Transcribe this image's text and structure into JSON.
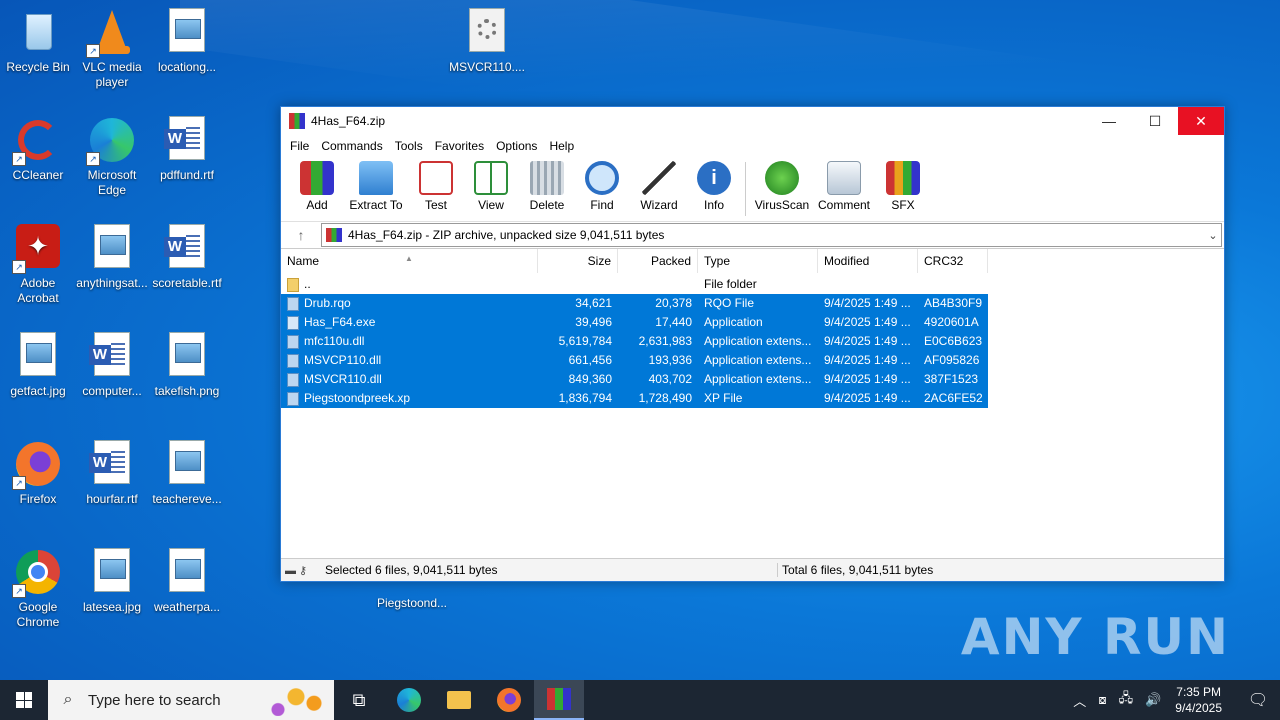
{
  "desktop": {
    "icons": [
      {
        "label": "Recycle Bin"
      },
      {
        "label": "VLC media player"
      },
      {
        "label": "locationg..."
      },
      {
        "label": "MSVCR110...."
      },
      {
        "label": "CCleaner"
      },
      {
        "label": "Microsoft Edge"
      },
      {
        "label": "pdffund.rtf"
      },
      {
        "label": "Adobe Acrobat"
      },
      {
        "label": "anythingsat..."
      },
      {
        "label": "scoretable.rtf"
      },
      {
        "label": "getfact.jpg"
      },
      {
        "label": "computer..."
      },
      {
        "label": "takefish.png"
      },
      {
        "label": "Firefox"
      },
      {
        "label": "hourfar.rtf"
      },
      {
        "label": "teachereve..."
      },
      {
        "label": "Google Chrome"
      },
      {
        "label": "latesea.jpg"
      },
      {
        "label": "weatherpa..."
      },
      {
        "label": "Piegstoond..."
      }
    ],
    "watermark": "ANY RUN"
  },
  "window": {
    "title": "4Has_F64.zip",
    "controls": {
      "minimize": "—",
      "maximize": "☐",
      "close": "✕"
    },
    "menu": [
      "File",
      "Commands",
      "Tools",
      "Favorites",
      "Options",
      "Help"
    ],
    "toolbar": [
      {
        "label": "Add",
        "icon": "add-archive-icon"
      },
      {
        "label": "Extract To",
        "icon": "extract-folder-icon"
      },
      {
        "label": "Test",
        "icon": "test-clipboard-icon"
      },
      {
        "label": "View",
        "icon": "view-book-icon"
      },
      {
        "label": "Delete",
        "icon": "trash-icon"
      },
      {
        "label": "Find",
        "icon": "magnifier-icon"
      },
      {
        "label": "Wizard",
        "icon": "wand-icon"
      },
      {
        "label": "Info",
        "icon": "info-icon"
      },
      {
        "label": "VirusScan",
        "icon": "bug-icon"
      },
      {
        "label": "Comment",
        "icon": "comment-icon"
      },
      {
        "label": "SFX",
        "icon": "sfx-books-icon"
      }
    ],
    "address": "4Has_F64.zip - ZIP archive, unpacked size 9,041,511 bytes",
    "columns": [
      "Name",
      "Size",
      "Packed",
      "Type",
      "Modified",
      "CRC32"
    ],
    "parent_row": {
      "name": "..",
      "type": "File folder"
    },
    "files": [
      {
        "name": "Drub.rqo",
        "size": "34,621",
        "packed": "20,378",
        "type": "RQO File",
        "modified": "9/4/2025 1:49 ...",
        "crc": "AB4B30F9"
      },
      {
        "name": "Has_F64.exe",
        "size": "39,496",
        "packed": "17,440",
        "type": "Application",
        "modified": "9/4/2025 1:49 ...",
        "crc": "4920601A"
      },
      {
        "name": "mfc110u.dll",
        "size": "5,619,784",
        "packed": "2,631,983",
        "type": "Application extens...",
        "modified": "9/4/2025 1:49 ...",
        "crc": "E0C6B623"
      },
      {
        "name": "MSVCP110.dll",
        "size": "661,456",
        "packed": "193,936",
        "type": "Application extens...",
        "modified": "9/4/2025 1:49 ...",
        "crc": "AF095826"
      },
      {
        "name": "MSVCR110.dll",
        "size": "849,360",
        "packed": "403,702",
        "type": "Application extens...",
        "modified": "9/4/2025 1:49 ...",
        "crc": "387F1523"
      },
      {
        "name": "Piegstoondpreek.xp",
        "size": "1,836,794",
        "packed": "1,728,490",
        "type": "XP File",
        "modified": "9/4/2025 1:49 ...",
        "crc": "2AC6FE52"
      }
    ],
    "status_left": "Selected 6 files, 9,041,511 bytes",
    "status_right": "Total 6 files, 9,041,511 bytes"
  },
  "taskbar": {
    "search_placeholder": "Type here to search",
    "time": "7:35 PM",
    "date": "9/4/2025"
  },
  "colors": {
    "selection": "#0078d7",
    "desktop": "#0b78d8",
    "taskbar": "#1c2633"
  }
}
